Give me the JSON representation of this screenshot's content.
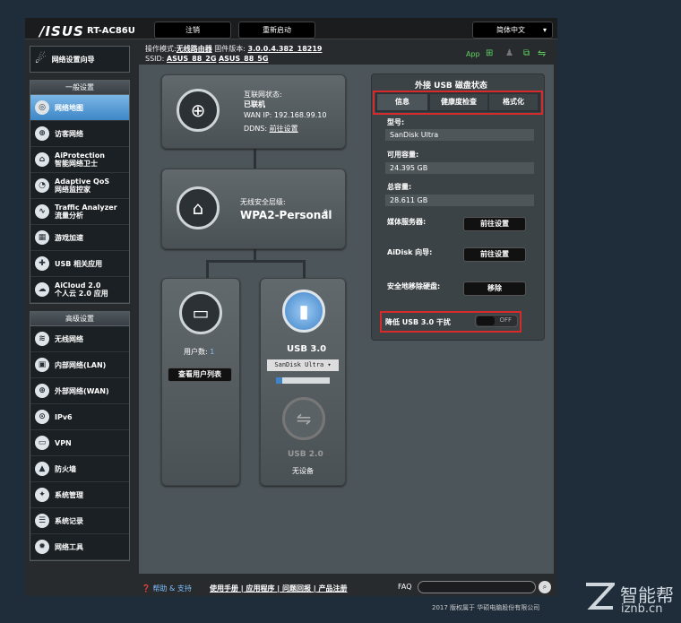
{
  "header": {
    "logo": "/ISUS",
    "model": "RT-AC86U",
    "logout": "注销",
    "reboot": "重新启动",
    "language": "简体中文"
  },
  "status": {
    "mode_label": "操作模式:",
    "mode": "无线路由器",
    "fw_label": "固件版本:",
    "fw": "3.0.0.4.382_18219",
    "ssid_label": "SSID:",
    "ssid1": "ASUS_88_2G",
    "ssid2": "ASUS_88_5G",
    "app": "App"
  },
  "wizard": "网络设置向导",
  "general": {
    "title": "一般设置",
    "items": [
      {
        "label": "网络地图",
        "label2": "",
        "icon": "map-icon"
      },
      {
        "label": "访客网络",
        "label2": "",
        "icon": "guest-icon"
      },
      {
        "label": "AiProtection",
        "label2": "智能网络卫士",
        "icon": "lock-icon"
      },
      {
        "label": "Adaptive QoS",
        "label2": "网络监控家",
        "icon": "gauge-icon"
      },
      {
        "label": "Traffic Analyzer",
        "label2": "流量分析",
        "icon": "wave-icon"
      },
      {
        "label": "游戏加速",
        "label2": "",
        "icon": "gamepad-icon"
      },
      {
        "label": "USB 相关应用",
        "label2": "",
        "icon": "puzzle-icon"
      },
      {
        "label": "AiCloud 2.0",
        "label2": "个人云 2.0 应用",
        "icon": "cloud-icon"
      }
    ]
  },
  "advanced": {
    "title": "高级设置",
    "items": [
      {
        "label": "无线网络",
        "icon": "wifi-icon"
      },
      {
        "label": "内部网络(LAN)",
        "icon": "lan-icon"
      },
      {
        "label": "外部网络(WAN)",
        "icon": "globe-icon"
      },
      {
        "label": "IPv6",
        "icon": "ipv6-icon"
      },
      {
        "label": "VPN",
        "icon": "vpn-icon"
      },
      {
        "label": "防火墙",
        "icon": "firewall-icon"
      },
      {
        "label": "系统管理",
        "icon": "admin-icon"
      },
      {
        "label": "系统记录",
        "icon": "log-icon"
      },
      {
        "label": "网络工具",
        "icon": "tools-icon"
      }
    ]
  },
  "internet": {
    "status_label": "互联网状态:",
    "status": "已联机",
    "wan_ip": "WAN IP: 192.168.99.10",
    "ddns_label": "DDNS:",
    "ddns": "前往设置"
  },
  "wireless": {
    "label": "无线安全层级:",
    "value": "WPA2-Personal"
  },
  "clients": {
    "label": "用户数:",
    "count": "1",
    "button": "查看用户列表"
  },
  "usb3": {
    "title": "USB 3.0",
    "device": "SanDisk Ultra ▾",
    "progress": 0.12
  },
  "usb2": {
    "title": "USB 2.0",
    "status": "无设备"
  },
  "usbpanel": {
    "title": "外接 USB 磁盘状态",
    "tabs": [
      "信息",
      "健康度检查",
      "格式化"
    ],
    "model_label": "型号:",
    "model": "SanDisk Ultra",
    "avail_label": "可用容量:",
    "avail": "24.395 GB",
    "total_label": "总容量:",
    "total": "28.611 GB",
    "media_label": "媒体服务器:",
    "media_btn": "前往设置",
    "aidisk_label": "AiDisk 向导:",
    "aidisk_btn": "前往设置",
    "remove_label": "安全地移除硬盘:",
    "remove_btn": "移除",
    "reduce_label": "降低 USB 3.0 干扰",
    "reduce_state": "OFF"
  },
  "footer": {
    "help": "帮助 & 支持",
    "links": "使用手册 | 应用程序 | 问题回报 | 产品注册",
    "faq": "FAQ",
    "copyright": "2017 版权属于 华硕电脑股份有限公司"
  },
  "watermark": {
    "cn": "智能帮",
    "url": "iznb.cn"
  }
}
